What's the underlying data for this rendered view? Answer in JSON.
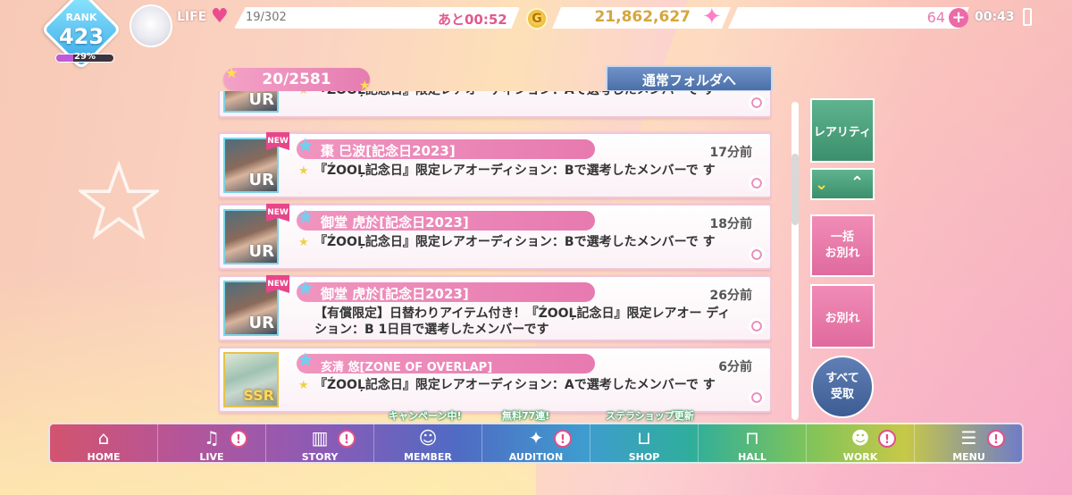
{
  "top_bar": {
    "rank_label": "RANK",
    "rank_value": "423",
    "exp_percent": 29,
    "exp_text": "29%",
    "life_label": "LIFE",
    "life_count": "19/302",
    "life_timer": "あと00:52",
    "coin_glyph": "G",
    "gold": "21,862,627",
    "gems": "64",
    "clock": "00:43"
  },
  "list_header": {
    "count": "20/2581",
    "folder_button": "通常フォルダへ"
  },
  "items": [
    {
      "name": "",
      "time": "",
      "description": "『ŹOOĻ記念日』限定レアオーディション：Aで選考したメンバーで す",
      "rarity": "UR",
      "new": false
    },
    {
      "name": "棗 巳波[記念日2023]",
      "time": "17分前",
      "description": "『ŹOOĻ記念日』限定レアオーディション：Bで選考したメンバーで す",
      "rarity": "UR",
      "new": true,
      "new_label": "NEW"
    },
    {
      "name": "御堂 虎於[記念日2023]",
      "time": "18分前",
      "description": "『ŹOOĻ記念日』限定レアオーディション：Bで選考したメンバーで す",
      "rarity": "UR",
      "new": true,
      "new_label": "NEW"
    },
    {
      "name": "御堂 虎於[記念日2023]",
      "time": "26分前",
      "description": "【有償限定】日替わりアイテム付き！『ŹOOĻ記念日』限定レアオー ディション：B 1日目で選考したメンバーです",
      "rarity": "UR",
      "new": true,
      "new_label": "NEW"
    },
    {
      "name": "亥清 悠[ZONE OF OVERLAP]",
      "time": "6分前",
      "description": "『ŹOOĻ記念日』限定レアオーディション：Aで選考したメンバーで す",
      "rarity": "SSR",
      "new": false
    }
  ],
  "side_buttons": {
    "rarity": "レアリティ",
    "bulk_release": "一括\nお別れ",
    "release": "お別れ",
    "receive_all": "すべて\n受取"
  },
  "banners": {
    "member": "キャンペーン中!",
    "audition": "無料77連!",
    "shop": "ステラショップ更新"
  },
  "nav": [
    {
      "label": "HOME",
      "icon": "home-icon",
      "glyph": "⌂",
      "alert": false
    },
    {
      "label": "LIVE",
      "icon": "music-note-icon",
      "glyph": "♫",
      "alert": true
    },
    {
      "label": "STORY",
      "icon": "book-icon",
      "glyph": "▥",
      "alert": true
    },
    {
      "label": "MEMBER",
      "icon": "member-icon",
      "glyph": "☺",
      "alert": false
    },
    {
      "label": "AUDITION",
      "icon": "audition-icon",
      "glyph": "✦",
      "alert": true
    },
    {
      "label": "SHOP",
      "icon": "cart-icon",
      "glyph": "⊔",
      "alert": false
    },
    {
      "label": "HALL",
      "icon": "hall-icon",
      "glyph": "⊓",
      "alert": false
    },
    {
      "label": "WORK",
      "icon": "work-icon",
      "glyph": "☻",
      "alert": true
    },
    {
      "label": "MENU",
      "icon": "menu-icon",
      "glyph": "☰",
      "alert": true
    }
  ],
  "alert_glyph": "!",
  "colors": {
    "accent_pink": "#e77ab0",
    "rank_blue": "#39a8e6",
    "green_button": "#3c8f6c",
    "navy_button": "#3d5c93"
  }
}
